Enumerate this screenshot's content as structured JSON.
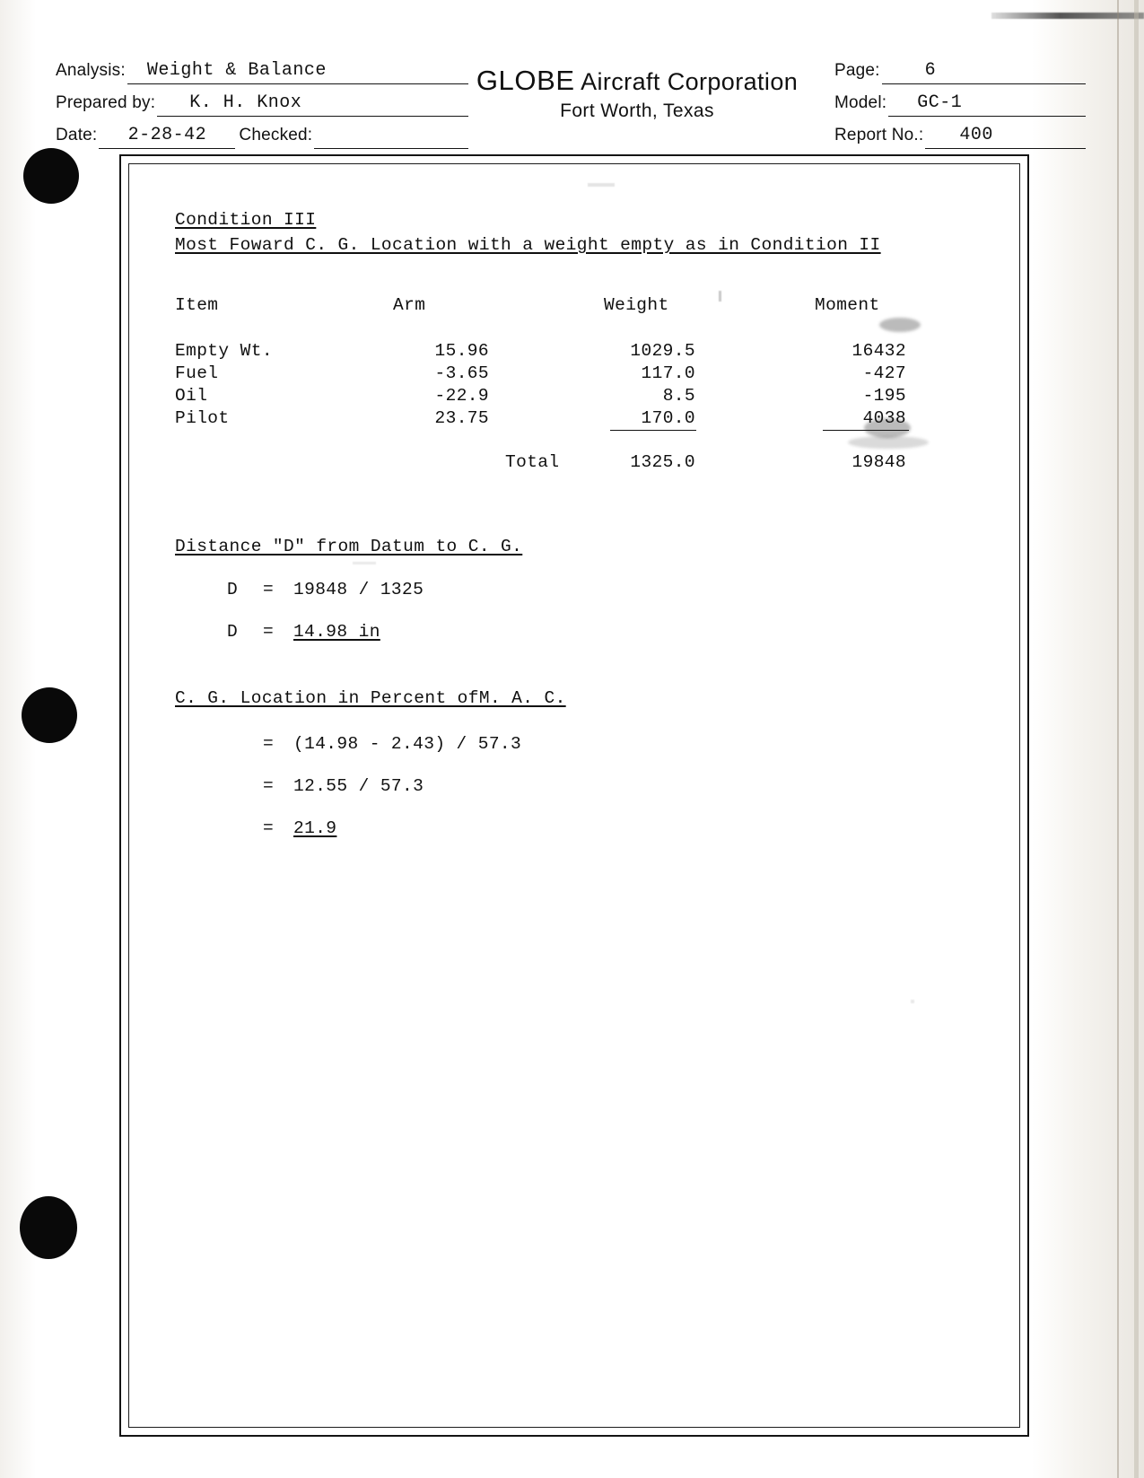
{
  "header": {
    "analysis_label": "Analysis:",
    "analysis_value": "Weight & Balance",
    "prepared_by_label": "Prepared by:",
    "prepared_by_value": "K. H. Knox",
    "date_label": "Date:",
    "date_value": "2-28-42",
    "checked_label": "Checked:",
    "checked_value": "",
    "company_name_bold": "GLOBE",
    "company_name_rest": "Aircraft Corporation",
    "company_city": "Fort Worth, Texas",
    "page_label": "Page:",
    "page_value": "6",
    "model_label": "Model:",
    "model_value": "GC-1",
    "report_no_label": "Report No.:",
    "report_no_value": "400"
  },
  "body": {
    "condition_title": "Condition III",
    "condition_subtitle": "Most Foward C. G. Location with a weight empty as in Condition II",
    "table": {
      "headers": [
        "Item",
        "Arm",
        "Weight",
        "Moment"
      ],
      "rows": [
        {
          "item": "Empty Wt.",
          "arm": "15.96",
          "weight": "1029.5",
          "moment": "16432"
        },
        {
          "item": "Fuel",
          "arm": "-3.65",
          "weight": "117.0",
          "moment": "-427"
        },
        {
          "item": "Oil",
          "arm": "-22.9",
          "weight": "8.5",
          "moment": "-195"
        },
        {
          "item": "Pilot",
          "arm": "23.75",
          "weight": "170.0",
          "moment": "4038"
        }
      ],
      "total_label": "Total",
      "total_weight": "1325.0",
      "total_moment": "19848"
    },
    "distance_section": {
      "heading": "Distance \"D\" from Datum to C. G.",
      "line1_var": "D",
      "line1_eq": "=",
      "line1_expr": "19848 / 1325",
      "line2_var": "D",
      "line2_eq": "=",
      "line2_result": "14.98 in"
    },
    "mac_section": {
      "heading": "C. G. Location in Percent ofM. A. C.",
      "line1_eq": "=",
      "line1_expr": "(14.98 - 2.43) / 57.3",
      "line2_eq": "=",
      "line2_expr": "12.55 / 57.3",
      "line3_eq": "=",
      "line3_result": "21.9"
    }
  }
}
